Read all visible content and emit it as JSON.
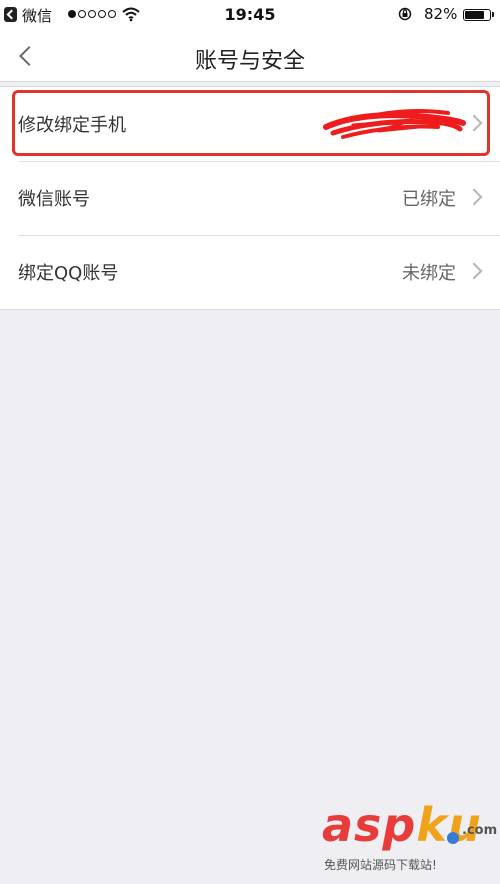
{
  "status_bar": {
    "app_name": "微信",
    "time": "19:45",
    "battery": "82%",
    "battery_level": 0.82,
    "signal_bars_filled": 1,
    "signal_bars_total": 5
  },
  "header": {
    "title": "账号与安全",
    "back_icon": "chevron-left-icon"
  },
  "settings": {
    "items": [
      {
        "label": "修改绑定手机",
        "value": ""
      },
      {
        "label": "微信账号",
        "value": "已绑定"
      },
      {
        "label": "绑定QQ账号",
        "value": "未绑定"
      }
    ]
  },
  "watermark": {
    "brand_asp": "asp",
    "brand_ku": "ku",
    "suffix": ".com",
    "tagline": "免费网站源码下载站!"
  },
  "colors": {
    "highlight": "#e2332f",
    "background": "#efeef3",
    "scribble": "#ee1c1c"
  }
}
